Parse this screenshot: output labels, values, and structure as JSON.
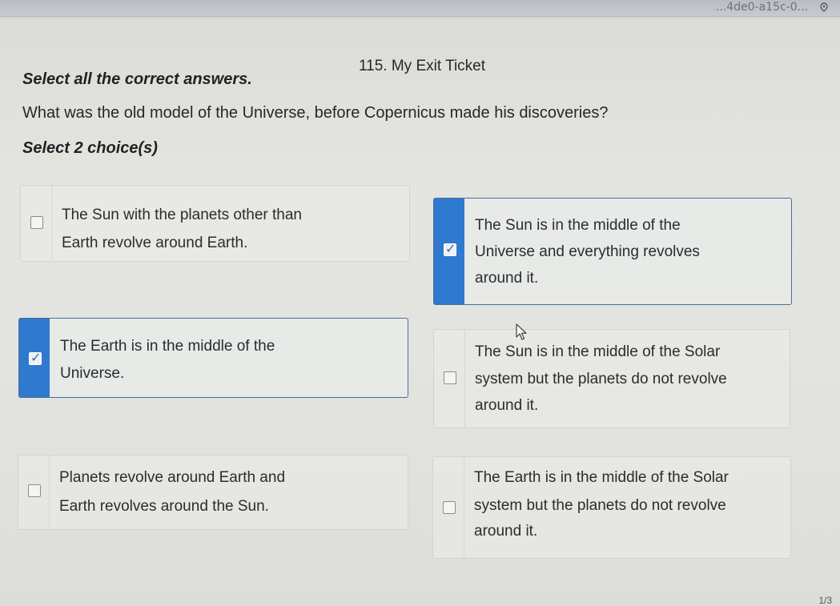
{
  "browser": {
    "url_fragment": "...4de0-a15c-0..."
  },
  "header": {
    "title": "115. My Exit Ticket"
  },
  "question": {
    "instruction": "Select all the correct answers.",
    "prompt": "What was the old model of the Universe, before Copernicus made his discoveries?",
    "select_count": "Select 2 choice(s)"
  },
  "choices": [
    {
      "lines": [
        "The Sun with the planets other than",
        "Earth revolve around Earth."
      ],
      "selected": false
    },
    {
      "lines": [
        "The Sun is in the middle of the",
        "Universe and everything revolves",
        "around it."
      ],
      "selected": true
    },
    {
      "lines": [
        "The Earth is in the middle of the",
        "Universe."
      ],
      "selected": true
    },
    {
      "lines": [
        "The Sun is in the middle of the Solar",
        "system but the planets do not revolve",
        "around it."
      ],
      "selected": false
    },
    {
      "lines": [
        "Planets revolve around Earth and",
        "Earth revolves around the Sun."
      ],
      "selected": false
    },
    {
      "lines": [
        "The Earth is in the middle of the Solar",
        "system but the planets do not revolve",
        "around it."
      ],
      "selected": false
    }
  ],
  "footer": {
    "page": "1/3"
  },
  "colors": {
    "selected_accent": "#2f79cf",
    "selected_border": "#4c6f9a"
  },
  "icons": {
    "checkbox_checked": "check-icon",
    "cursor": "pointer-cursor-icon",
    "location": "location-pin-icon"
  }
}
